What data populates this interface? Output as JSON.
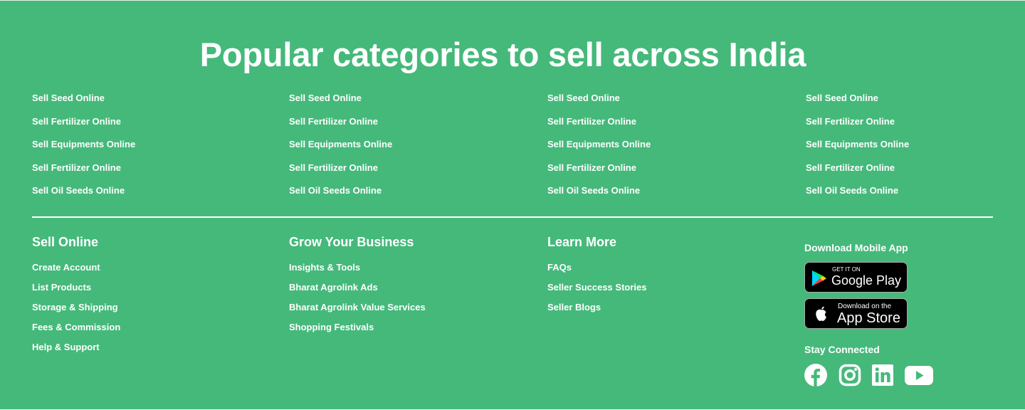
{
  "popular": {
    "title": "Popular categories to sell across India",
    "columns": [
      [
        "Sell Seed Online",
        "Sell Fertilizer Online",
        "Sell Equipments Online",
        "Sell Fertilizer Online",
        "Sell Oil Seeds Online"
      ],
      [
        "Sell Seed Online",
        "Sell Fertilizer Online",
        "Sell Equipments Online",
        "Sell Fertilizer Online",
        "Sell Oil Seeds Online"
      ],
      [
        "Sell Seed Online",
        "Sell Fertilizer Online",
        "Sell Equipments Online",
        "Sell Fertilizer Online",
        "Sell Oil Seeds Online"
      ],
      [
        "Sell Seed Online",
        "Sell Fertilizer Online",
        "Sell Equipments Online",
        "Sell Fertilizer Online",
        "Sell Oil Seeds Online"
      ]
    ]
  },
  "sections": [
    {
      "heading": "Sell Online",
      "links": [
        "Create Account",
        "List Products",
        "Storage & Shipping",
        "Fees & Commission",
        "Help & Support"
      ]
    },
    {
      "heading": "Grow Your Business",
      "links": [
        "Insights & Tools",
        "Bharat Agrolink Ads",
        "Bharat Agrolink Value Services",
        "Shopping Festivals"
      ]
    },
    {
      "heading": "Learn More",
      "links": [
        "FAQs",
        "Seller Success Stories",
        "Seller Blogs"
      ]
    }
  ],
  "app": {
    "heading": "Download Mobile App",
    "google_play": {
      "small": "GET IT ON",
      "big": "Google Play"
    },
    "app_store": {
      "small": "Download on the",
      "big": "App Store"
    }
  },
  "social": {
    "heading": "Stay Connected",
    "icons": [
      "facebook-icon",
      "instagram-icon",
      "linkedin-icon",
      "youtube-icon"
    ]
  },
  "colors": {
    "background": "#45b97a",
    "text": "#ffffff",
    "badge": "#000000"
  }
}
